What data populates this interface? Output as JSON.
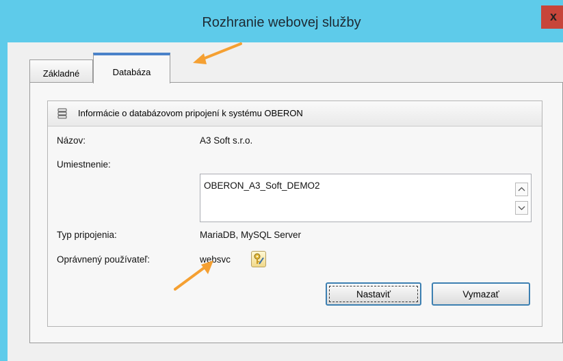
{
  "window": {
    "title": "Rozhranie webovej služby",
    "close_label": "x"
  },
  "tabs": [
    {
      "label": "Základné",
      "active": false
    },
    {
      "label": "Databáza",
      "active": true
    }
  ],
  "group": {
    "icon": "database-icon",
    "title": "Informácie o databázovom pripojení k systému OBERON"
  },
  "fields": {
    "name_label": "Názov:",
    "name_value": "A3 Soft s.r.o.",
    "location_label": "Umiestnenie:",
    "location_value": "OBERON_A3_Soft_DEMO2",
    "type_label": "Typ pripojenia:",
    "type_value": "MariaDB, MySQL Server",
    "user_label": "Oprávnený používateľ:",
    "user_value": "websvc",
    "user_icon": "key-pencil-icon"
  },
  "buttons": {
    "set_label": "Nastaviť",
    "clear_label": "Vymazať"
  },
  "colors": {
    "titlebar": "#5ecbea",
    "arrow": "#f5a032",
    "active_tab_accent": "#4a82c9"
  }
}
